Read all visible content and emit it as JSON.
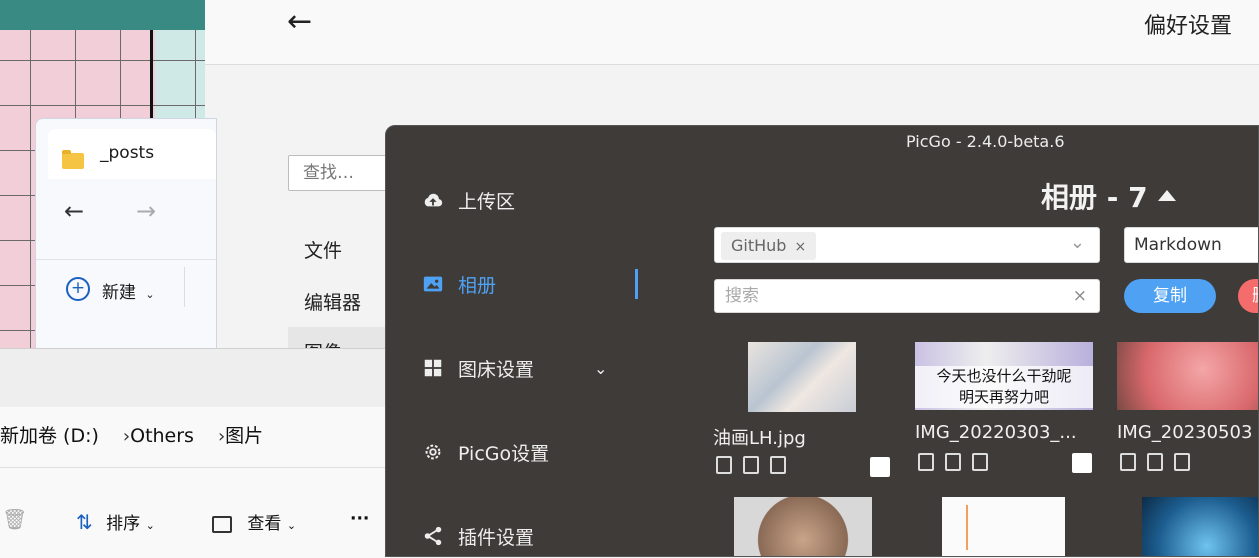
{
  "settings": {
    "title": "偏好设置",
    "search_placeholder": "查找…",
    "nav": [
      "文件",
      "编辑器",
      "图像"
    ]
  },
  "explorer_posts": {
    "tab_label": "_posts",
    "new_label": "新建"
  },
  "explorer_pictures": {
    "breadcrumb": [
      "新加卷 (D:)",
      "Others",
      "图片"
    ],
    "toolbar": {
      "sort_label": "排序",
      "view_label": "查看",
      "more_label": "···"
    }
  },
  "picgo": {
    "window_title": "PicGo - 2.4.0-beta.6",
    "sidebar": [
      {
        "label": "上传区",
        "icon": "cloud-upload-icon"
      },
      {
        "label": "相册",
        "icon": "image-icon",
        "active": true
      },
      {
        "label": "图床设置",
        "icon": "grid-icon"
      },
      {
        "label": "PicGo设置",
        "icon": "gear-icon"
      },
      {
        "label": "插件设置",
        "icon": "share-icon"
      }
    ],
    "album_title": "相册 - 7",
    "filter_tag": "GitHub",
    "filter_tag_close": "×",
    "format_select": "Markdown",
    "search_placeholder": "搜索",
    "copy_button": "复制",
    "delete_button_partial": "删",
    "images": [
      {
        "name": "油画LH.jpg",
        "thumb_text": ""
      },
      {
        "name": "IMG_20220303_...",
        "thumb_text": "今天也没什么干劲呢\n明天再努力吧"
      },
      {
        "name": "IMG_20230503",
        "thumb_text": ""
      }
    ],
    "colors": {
      "accent": "#4ea1f3",
      "bg": "#3f3b38",
      "copy": "#4ea1f3",
      "delete": "#f56c6c"
    }
  }
}
